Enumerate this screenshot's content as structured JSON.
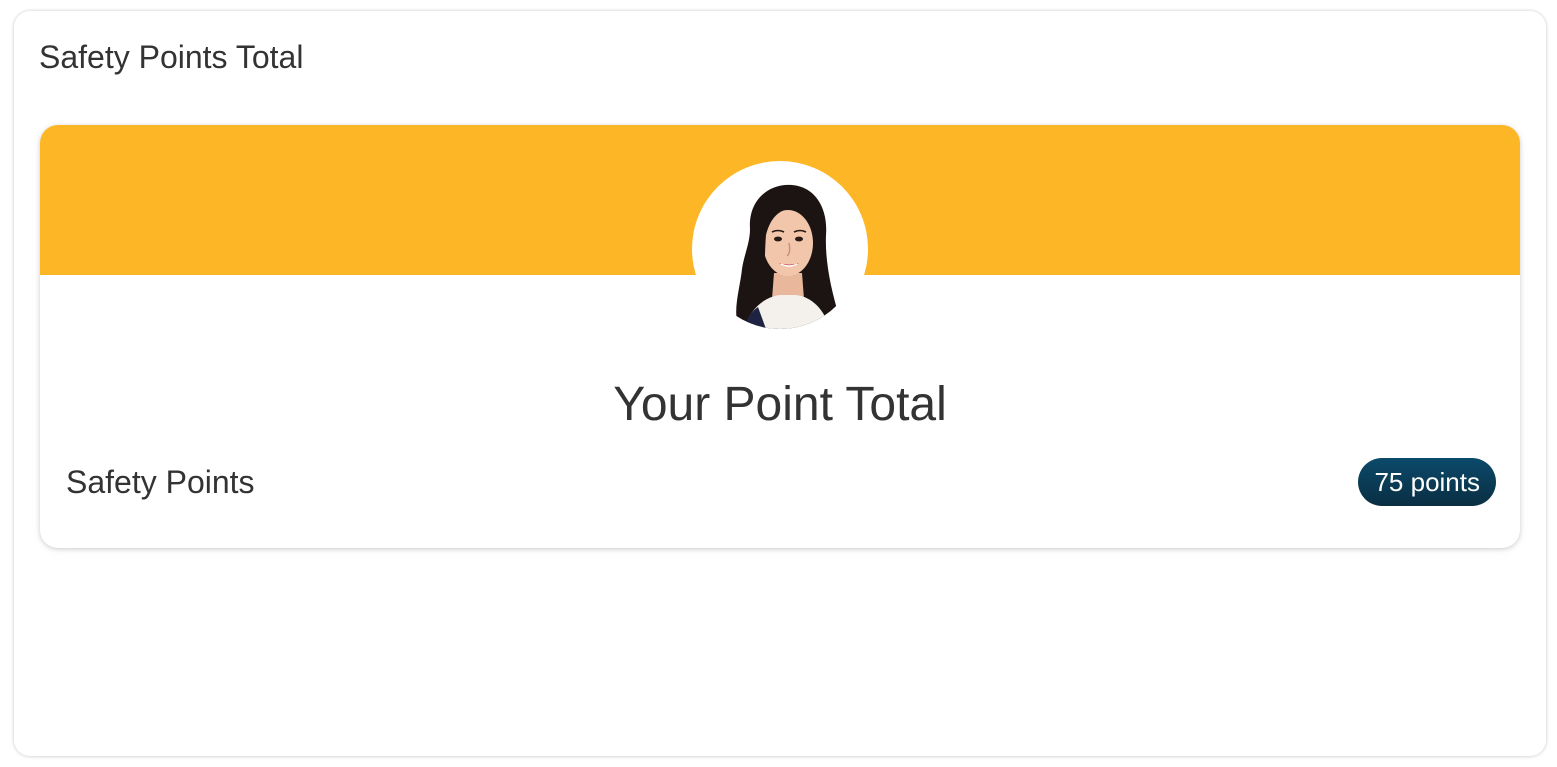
{
  "widget": {
    "title": "Safety Points Total"
  },
  "profile_card": {
    "heading": "Your Point Total",
    "banner_color": "#FDB726",
    "avatar_icon": "user-photo",
    "points": {
      "label": "Safety Points",
      "value": "75 points",
      "badge_color_top": "#0B4A6B",
      "badge_color_bottom": "#0A2E42"
    }
  }
}
